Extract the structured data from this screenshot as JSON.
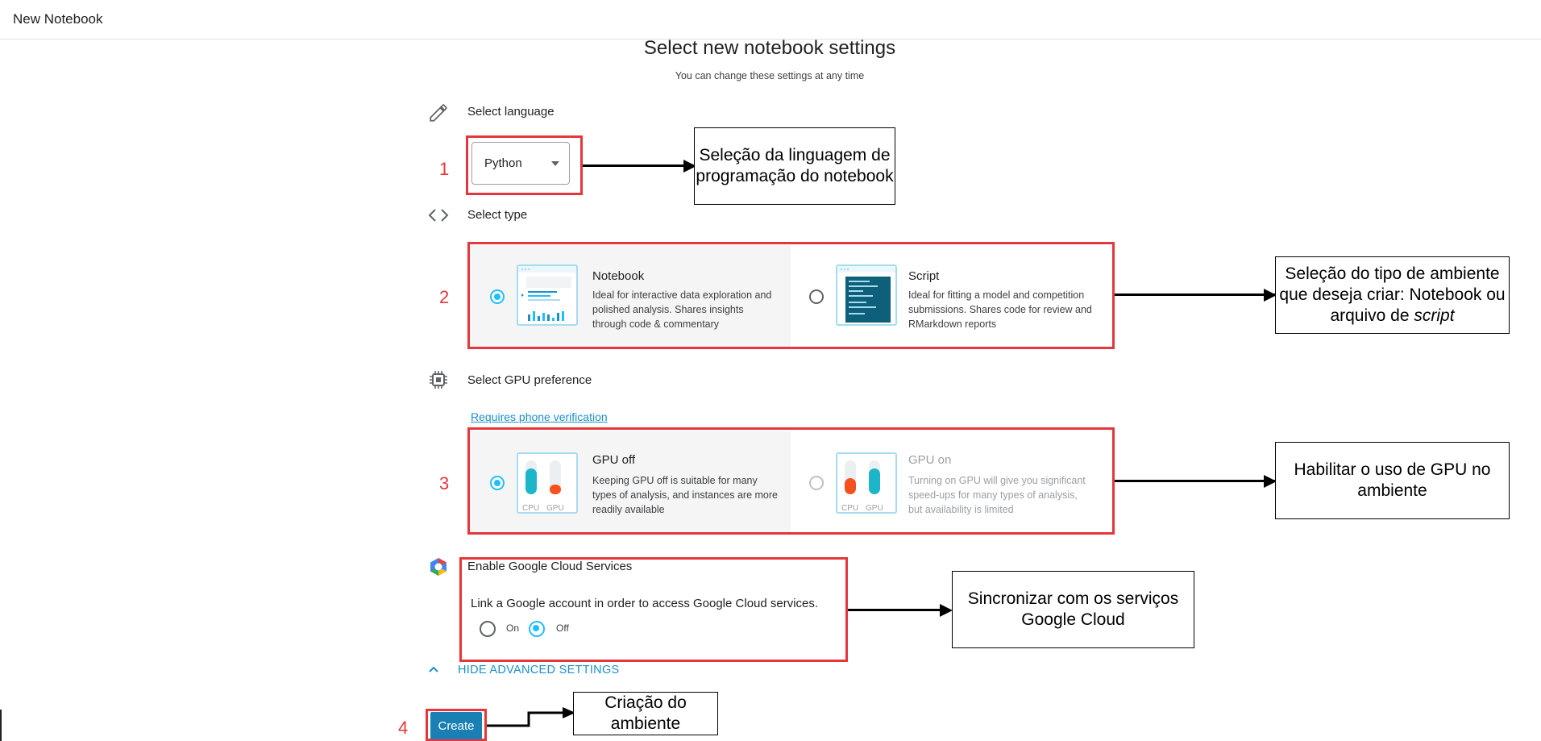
{
  "header": {
    "title": "New Notebook"
  },
  "main": {
    "title": "Select new notebook settings",
    "subtitle": "You can change these settings at any time",
    "language": {
      "label": "Select language",
      "value": "Python"
    },
    "type": {
      "label": "Select type",
      "options": [
        {
          "title": "Notebook",
          "description": "Ideal for interactive data exploration and polished analysis. Shares insights through code & commentary",
          "selected": true
        },
        {
          "title": "Script",
          "description": "Ideal for fitting a model and competition submissions. Shares code for review and RMarkdown reports",
          "selected": false
        }
      ]
    },
    "gpu": {
      "label": "Select GPU preference",
      "link": "Requires phone verification",
      "options": [
        {
          "title": "GPU off",
          "description": "Keeping GPU off is suitable for many types of analysis, and instances are more readily available",
          "selected": true,
          "cpu_label": "CPU",
          "gpu_label": "GPU"
        },
        {
          "title": "GPU on",
          "description": "Turning on GPU will give you significant speed-ups for many types of analysis, but availability is limited",
          "selected": false,
          "cpu_label": "CPU",
          "gpu_label": "GPU"
        }
      ]
    },
    "cloud": {
      "label": "Enable Google Cloud Services",
      "description": "Link a Google account in order to access Google Cloud services.",
      "on_label": "On",
      "off_label": "Off",
      "selected": "Off"
    },
    "advanced_toggle": "HIDE ADVANCED SETTINGS",
    "create_label": "Create"
  },
  "annotations": {
    "numbers": [
      "1",
      "2",
      "3",
      "4"
    ],
    "callouts": [
      "Seleção da linguagem de programação do notebook",
      "Seleção do tipo de ambiente que deseja criar: Notebook ou arquivo de",
      "script",
      "Habilitar o uso de GPU no ambiente",
      "Sincronizar com os serviços Google Cloud",
      "Criação do ambiente"
    ]
  },
  "colors": {
    "accent": "#20beff",
    "annotation_red": "#e5363b",
    "button_blue": "#1a7fb4",
    "gpu_bar_teal": "#1cb5c9",
    "gpu_bar_orange": "#f4511e"
  }
}
